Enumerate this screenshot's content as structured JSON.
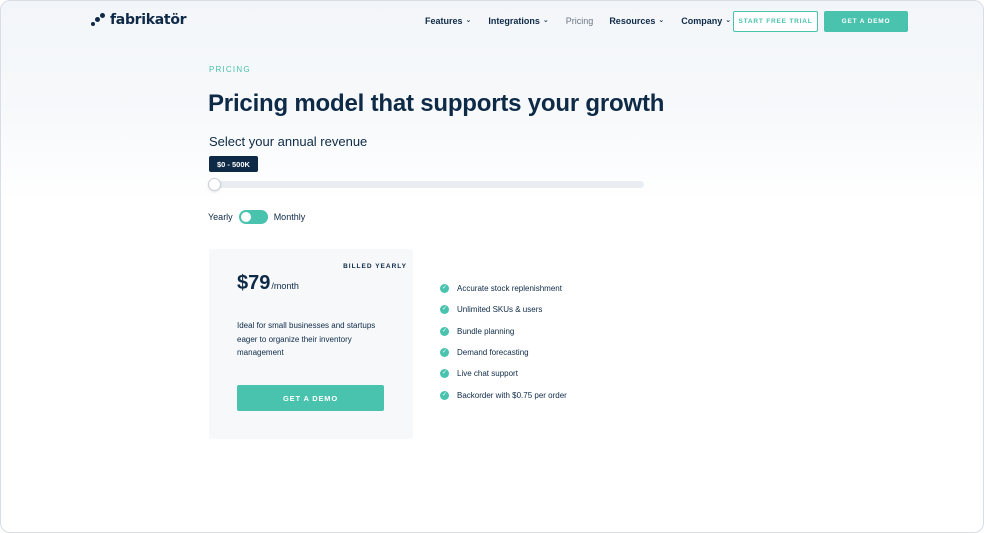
{
  "brand": {
    "name": "fabrikatör"
  },
  "nav": {
    "items": [
      {
        "label": "Features",
        "has_dropdown": true
      },
      {
        "label": "Integrations",
        "has_dropdown": true
      },
      {
        "label": "Pricing",
        "has_dropdown": false
      },
      {
        "label": "Resources",
        "has_dropdown": true
      },
      {
        "label": "Company",
        "has_dropdown": true
      }
    ],
    "trial_button": "START FREE TRIAL",
    "demo_button": "GET A DEMO"
  },
  "hero": {
    "eyebrow": "PRICING",
    "title": "Pricing model that supports your growth",
    "subtitle": "Select your annual revenue",
    "revenue_range": "$0 - 500K",
    "slider_value": 0
  },
  "billing_toggle": {
    "left_label": "Yearly",
    "right_label": "Monthly",
    "selected": "Yearly"
  },
  "plan": {
    "billing_note": "BILLED YEARLY",
    "price": "$79",
    "period": "/month",
    "description": "Ideal for small businesses and startups eager to organize their inventory management",
    "cta": "GET A DEMO"
  },
  "features": [
    "Accurate stock replenishment",
    "Unlimited SKUs & users",
    "Bundle planning",
    "Demand forecasting",
    "Live chat support",
    "Backorder with $0.75 per order"
  ],
  "colors": {
    "accent": "#49c2ae",
    "navy": "#0e2a47",
    "card_bg": "#f6f8fa"
  }
}
